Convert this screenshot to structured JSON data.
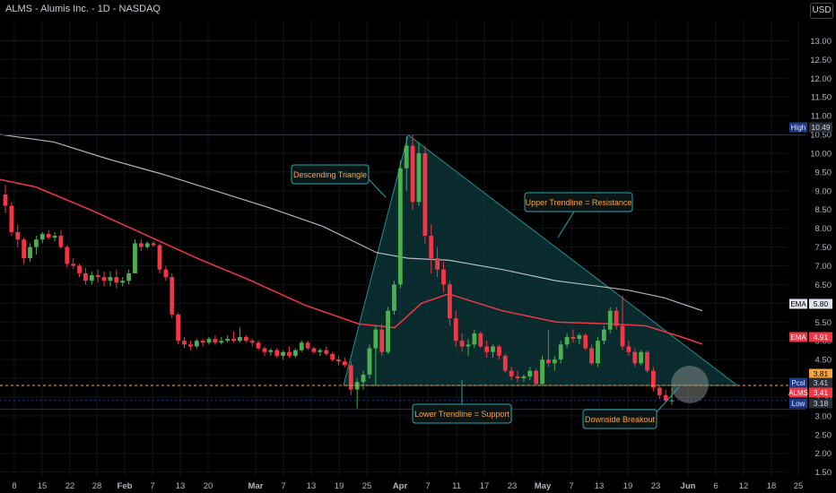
{
  "header": {
    "title": "ALMS - Alumis Inc. - 1D - NASDAQ",
    "currency_button": "USD"
  },
  "colors": {
    "background": "#000000",
    "grid": "#111418",
    "axis_text": "#b2b5be",
    "up_candle": "#26a69a",
    "up_candle_bright": "#4caf50",
    "down_candle": "#f23645",
    "ema_short": "#f23645",
    "ema_long": "#d1d4dc",
    "triangle_fill": "#0d3a3c",
    "triangle_edge": "#2a8c8c",
    "callout_border": "#26a6a6",
    "callout_text": "#f7a440",
    "support_line": "#f7a440",
    "breakout_circle": "#9e9e9e"
  },
  "chart_data": {
    "type": "candlestick",
    "title": "ALMS - Alumis Inc. - 1D - NASDAQ",
    "x_axis": {
      "ticks": [
        "8",
        "15",
        "22",
        "28",
        "Feb",
        "7",
        "13",
        "20",
        "Mar",
        "7",
        "13",
        "19",
        "25",
        "Apr",
        "7",
        "11",
        "17",
        "23",
        "May",
        "7",
        "13",
        "19",
        "23",
        "Jun",
        "6",
        "12",
        "18",
        "25"
      ]
    },
    "y_axis": {
      "currency": "USD",
      "ylim": [
        1.3,
        13.4
      ],
      "ticks": [
        "1.50",
        "2.00",
        "2.50",
        "3.00",
        "3.50",
        "4.00",
        "4.50",
        "5.00",
        "5.50",
        "6.00",
        "6.50",
        "7.00",
        "7.50",
        "8.00",
        "8.50",
        "9.00",
        "9.50",
        "10.00",
        "10.50",
        "11.00",
        "11.50",
        "12.00",
        "12.50",
        "13.00"
      ]
    },
    "price_labels": [
      {
        "name": "High",
        "value": "10.49",
        "color": "#2962ff"
      },
      {
        "name": "EMA",
        "value": "5.80",
        "color": "#d1d4dc"
      },
      {
        "name": "EMA",
        "value": "4.91",
        "color": "#f23645"
      },
      {
        "name": "",
        "value": "3.81",
        "color": "#f7a440"
      },
      {
        "name": "Pcsl",
        "value": "3.41",
        "color": "#2962ff"
      },
      {
        "name": "ALMS",
        "value": "3.41",
        "color": "#f23645"
      },
      {
        "name": "Low",
        "value": "3.18",
        "color": "#2962ff"
      }
    ],
    "annotations": [
      "Descending Triangle",
      "Upper Trendline = Resistance",
      "Lower Trendline = Support",
      "Downside Breakout"
    ],
    "levels": {
      "high": 10.49,
      "low": 3.18,
      "support": 3.81,
      "last": 3.41
    },
    "candles": [
      [
        8.9,
        9.15,
        8.4,
        8.6
      ],
      [
        8.6,
        8.7,
        7.8,
        7.9
      ],
      [
        7.9,
        8.1,
        7.5,
        7.7
      ],
      [
        7.7,
        7.75,
        7.05,
        7.2
      ],
      [
        7.2,
        7.6,
        7.1,
        7.5
      ],
      [
        7.5,
        7.8,
        7.3,
        7.7
      ],
      [
        7.7,
        7.9,
        7.6,
        7.85
      ],
      [
        7.85,
        7.95,
        7.7,
        7.75
      ],
      [
        7.75,
        7.9,
        7.65,
        7.8
      ],
      [
        7.8,
        7.95,
        7.45,
        7.5
      ],
      [
        7.5,
        7.55,
        6.95,
        7.05
      ],
      [
        7.05,
        7.2,
        6.9,
        7.0
      ],
      [
        7.0,
        7.05,
        6.7,
        6.8
      ],
      [
        6.8,
        6.95,
        6.5,
        6.6
      ],
      [
        6.6,
        6.85,
        6.5,
        6.75
      ],
      [
        6.75,
        6.9,
        6.55,
        6.7
      ],
      [
        6.7,
        6.85,
        6.45,
        6.6
      ],
      [
        6.6,
        6.85,
        6.45,
        6.7
      ],
      [
        6.7,
        6.9,
        6.4,
        6.55
      ],
      [
        6.55,
        6.7,
        6.45,
        6.6
      ],
      [
        6.6,
        6.9,
        6.5,
        6.8
      ],
      [
        6.8,
        7.7,
        6.8,
        7.6
      ],
      [
        7.6,
        7.7,
        7.4,
        7.5
      ],
      [
        7.5,
        7.65,
        7.45,
        7.6
      ],
      [
        7.6,
        7.65,
        7.5,
        7.55
      ],
      [
        7.55,
        7.6,
        6.8,
        6.9
      ],
      [
        6.9,
        7.0,
        6.6,
        6.7
      ],
      [
        6.7,
        6.8,
        5.6,
        5.7
      ],
      [
        5.7,
        5.75,
        4.9,
        5.0
      ],
      [
        5.0,
        5.1,
        4.8,
        4.9
      ],
      [
        4.9,
        5.0,
        4.75,
        4.85
      ],
      [
        4.85,
        5.05,
        4.8,
        5.0
      ],
      [
        5.0,
        5.05,
        4.85,
        4.95
      ],
      [
        4.95,
        5.1,
        4.9,
        5.05
      ],
      [
        5.05,
        5.15,
        4.9,
        4.95
      ],
      [
        4.95,
        5.1,
        4.9,
        5.0
      ],
      [
        5.0,
        5.15,
        4.95,
        5.05
      ],
      [
        5.05,
        5.25,
        4.95,
        5.0
      ],
      [
        5.0,
        5.35,
        4.95,
        5.1
      ],
      [
        5.1,
        5.15,
        4.95,
        5.0
      ],
      [
        5.0,
        5.05,
        4.85,
        4.95
      ],
      [
        4.95,
        5.0,
        4.75,
        4.8
      ],
      [
        4.8,
        4.85,
        4.6,
        4.7
      ],
      [
        4.7,
        4.8,
        4.6,
        4.75
      ],
      [
        4.75,
        4.8,
        4.55,
        4.6
      ],
      [
        4.6,
        4.75,
        4.5,
        4.7
      ],
      [
        4.7,
        4.85,
        4.55,
        4.6
      ],
      [
        4.6,
        4.8,
        4.55,
        4.75
      ],
      [
        4.75,
        5.0,
        4.7,
        4.95
      ],
      [
        4.95,
        5.0,
        4.75,
        4.8
      ],
      [
        4.8,
        4.85,
        4.65,
        4.7
      ],
      [
        4.7,
        4.8,
        4.6,
        4.75
      ],
      [
        4.75,
        4.85,
        4.6,
        4.65
      ],
      [
        4.65,
        4.7,
        4.45,
        4.5
      ],
      [
        4.5,
        4.6,
        4.35,
        4.45
      ],
      [
        4.45,
        4.55,
        4.3,
        4.35
      ],
      [
        4.35,
        4.45,
        3.55,
        3.7
      ],
      [
        3.7,
        4.0,
        3.2,
        3.9
      ],
      [
        3.9,
        4.2,
        3.7,
        4.1
      ],
      [
        4.1,
        4.9,
        4.0,
        4.8
      ],
      [
        4.8,
        5.4,
        3.8,
        5.3
      ],
      [
        5.3,
        5.45,
        4.6,
        4.7
      ],
      [
        4.7,
        5.9,
        4.65,
        5.8
      ],
      [
        5.8,
        6.6,
        5.7,
        6.5
      ],
      [
        6.5,
        9.8,
        6.4,
        9.6
      ],
      [
        9.6,
        10.45,
        9.0,
        10.2
      ],
      [
        10.2,
        10.49,
        8.5,
        8.7
      ],
      [
        8.7,
        10.3,
        8.6,
        10.0
      ],
      [
        10.0,
        10.2,
        7.6,
        7.8
      ],
      [
        7.8,
        8.1,
        6.8,
        7.2
      ],
      [
        7.2,
        7.5,
        6.7,
        6.9
      ],
      [
        6.9,
        7.1,
        6.3,
        6.5
      ],
      [
        6.5,
        6.6,
        5.4,
        5.6
      ],
      [
        5.6,
        5.8,
        4.85,
        5.0
      ],
      [
        5.0,
        5.2,
        4.7,
        4.85
      ],
      [
        4.85,
        5.05,
        4.6,
        4.9
      ],
      [
        4.9,
        5.3,
        4.8,
        5.2
      ],
      [
        5.2,
        5.25,
        4.8,
        4.85
      ],
      [
        4.85,
        5.0,
        4.55,
        4.7
      ],
      [
        4.7,
        4.9,
        4.55,
        4.85
      ],
      [
        4.85,
        4.9,
        4.5,
        4.6
      ],
      [
        4.6,
        4.65,
        4.15,
        4.2
      ],
      [
        4.2,
        4.3,
        3.95,
        4.05
      ],
      [
        4.05,
        4.2,
        3.9,
        4.0
      ],
      [
        4.0,
        4.1,
        3.9,
        4.05
      ],
      [
        4.05,
        4.3,
        3.95,
        4.2
      ],
      [
        4.2,
        4.25,
        3.8,
        3.85
      ],
      [
        3.85,
        4.6,
        3.8,
        4.5
      ],
      [
        4.5,
        5.3,
        4.3,
        4.4
      ],
      [
        4.4,
        4.6,
        4.2,
        4.5
      ],
      [
        4.5,
        5.0,
        4.4,
        4.9
      ],
      [
        4.9,
        5.2,
        4.8,
        5.1
      ],
      [
        5.1,
        5.3,
        4.95,
        5.05
      ],
      [
        5.05,
        5.2,
        4.9,
        5.15
      ],
      [
        5.15,
        5.2,
        4.75,
        4.8
      ],
      [
        4.8,
        4.9,
        4.35,
        4.4
      ],
      [
        4.4,
        5.1,
        4.3,
        5.0
      ],
      [
        5.0,
        5.4,
        4.9,
        5.3
      ],
      [
        5.3,
        5.9,
        5.2,
        5.8
      ],
      [
        5.8,
        5.9,
        5.3,
        5.4
      ],
      [
        5.4,
        6.2,
        4.75,
        4.85
      ],
      [
        4.85,
        5.0,
        4.6,
        4.7
      ],
      [
        4.7,
        4.8,
        4.3,
        4.4
      ],
      [
        4.4,
        4.75,
        4.35,
        4.7
      ],
      [
        4.7,
        4.75,
        4.15,
        4.2
      ],
      [
        4.2,
        4.3,
        3.65,
        3.75
      ],
      [
        3.75,
        3.8,
        3.45,
        3.55
      ],
      [
        3.55,
        3.7,
        3.35,
        3.4
      ],
      [
        3.4,
        3.75,
        3.3,
        3.41
      ]
    ]
  }
}
